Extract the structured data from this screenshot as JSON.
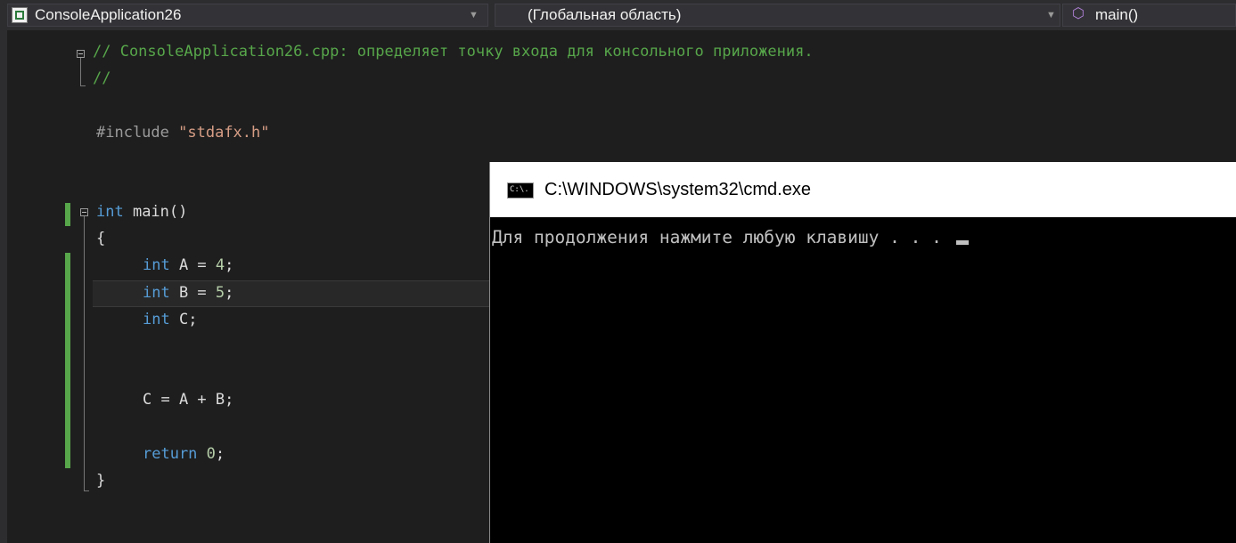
{
  "navbar": {
    "project": "ConsoleApplication26",
    "scope": "(Глобальная область)",
    "member": "main()",
    "project_icon": "cpp-project-icon",
    "member_icon": "method-icon",
    "dropdown_icon": "chevron-down-icon"
  },
  "code": {
    "line1": "// ConsoleApplication26.cpp: определяет точку входа для консольного приложения.",
    "line2": "//",
    "include_kw": "#include",
    "include_file": "\"stdafx.h\"",
    "main_kw": "int",
    "main_name": " main()",
    "open_brace": "{",
    "a_kw": "int",
    "a_rest": " A = ",
    "a_val": "4",
    "a_end": ";",
    "b_kw": "int",
    "b_rest": " B = ",
    "b_val": "5",
    "b_end": ";",
    "c_kw": "int",
    "c_rest": " C;",
    "sum": "C = A + B;",
    "ret_kw": "return",
    "ret_val": " 0",
    "ret_end": ";",
    "close_brace": "}"
  },
  "console": {
    "title": "C:\\WINDOWS\\system32\\cmd.exe",
    "icon_text": "C:\\.",
    "output": "Для продолжения нажмите любую клавишу . . . "
  },
  "colors": {
    "editor_bg": "#1e1e1e",
    "comment": "#57a64a",
    "keyword": "#569cd6",
    "string": "#d69d85",
    "number": "#b5cea8",
    "change_bar": "#57a64a"
  }
}
